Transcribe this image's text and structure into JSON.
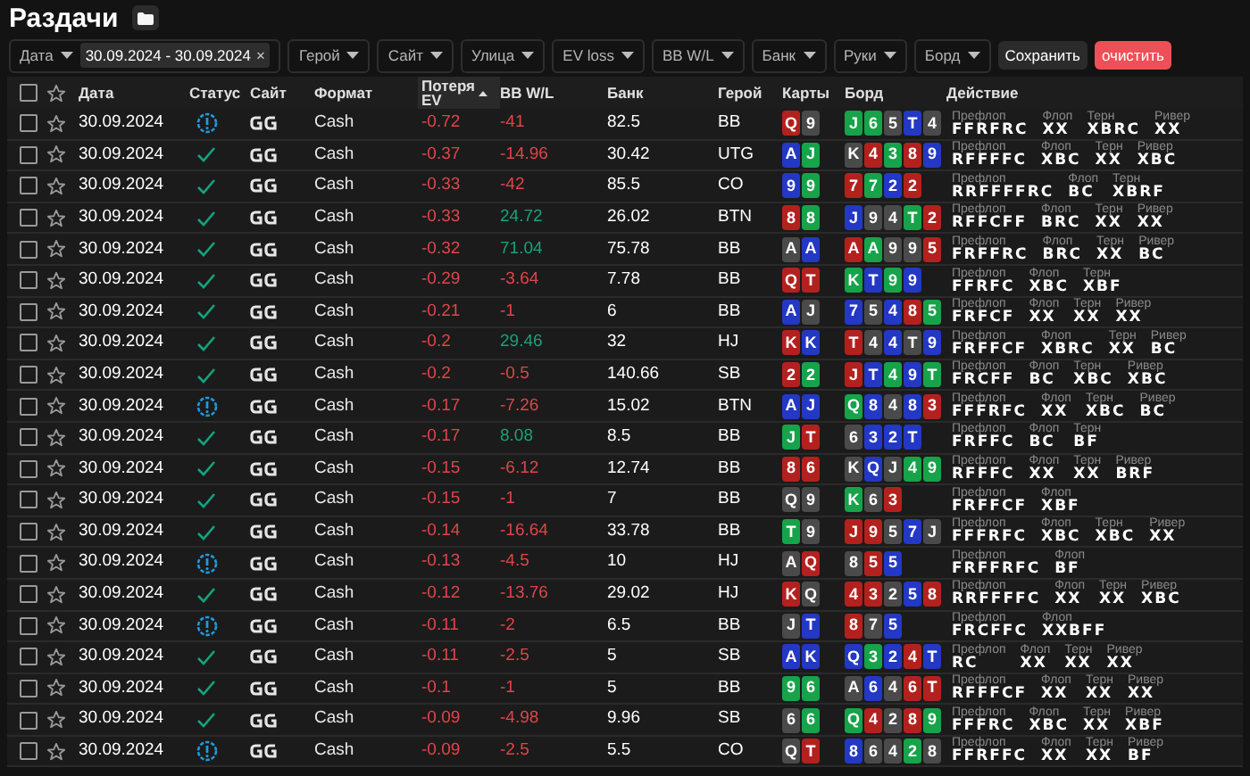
{
  "title": "Раздачи",
  "filters": [
    {
      "label": "Дата",
      "chip": "30.09.2024 - 30.09.2024",
      "chip_close": "×"
    },
    {
      "label": "Герой"
    },
    {
      "label": "Сайт"
    },
    {
      "label": "Улица"
    },
    {
      "label": "EV loss"
    },
    {
      "label": "BB W/L"
    },
    {
      "label": "Банк"
    },
    {
      "label": "Руки"
    },
    {
      "label": "Борд"
    }
  ],
  "save_button": "Сохранить",
  "clear_button": "очистить",
  "header_checkbox": {
    "checked": false
  },
  "columns": [
    {
      "label": "Дата",
      "sorted": false
    },
    {
      "label": "Статус",
      "sorted": false
    },
    {
      "label": "Сайт",
      "sorted": false
    },
    {
      "label": "Формат",
      "sorted": false
    },
    {
      "label": "Потеря EV",
      "sorted": true
    },
    {
      "label": "BB W/L",
      "sorted": false
    },
    {
      "label": "Банк",
      "sorted": false
    },
    {
      "label": "Герой",
      "sorted": false
    },
    {
      "label": "Карты",
      "sorted": false
    },
    {
      "label": "Борд",
      "sorted": false
    },
    {
      "label": "Действие",
      "sorted": false
    }
  ],
  "rows": [
    {
      "checked": false,
      "starred": false,
      "date": "30.09.2024",
      "kind": "warning",
      "format": "Cash",
      "ev_loss": "-0.72",
      "bb_wl": "-41",
      "positive": false,
      "pot": "82.5",
      "hero": "BB",
      "cards": [
        {
          "rank": "Q",
          "color": "#b3211e"
        },
        {
          "rank": "9",
          "color": "#4a4a4a"
        }
      ],
      "board": [
        {
          "rank": "J",
          "color": "#16a34a"
        },
        {
          "rank": "6",
          "color": "#16a34a"
        },
        {
          "rank": "5",
          "color": "#4a4a4a"
        },
        {
          "rank": "T",
          "color": "#2338c4"
        },
        {
          "rank": "4",
          "color": "#4a4a4a"
        }
      ],
      "action": [
        {
          "street": "Префлоп",
          "value": "FFRFRC"
        },
        {
          "street": "Флоп",
          "value": "XX"
        },
        {
          "street": "Терн",
          "value": "XBRC"
        },
        {
          "street": "Ривер",
          "value": "XX"
        }
      ]
    },
    {
      "checked": false,
      "starred": false,
      "date": "30.09.2024",
      "kind": "ok",
      "format": "Cash",
      "ev_loss": "-0.37",
      "bb_wl": "-14.96",
      "positive": false,
      "pot": "30.42",
      "hero": "UTG",
      "cards": [
        {
          "rank": "A",
          "color": "#2338c4"
        },
        {
          "rank": "J",
          "color": "#16a34a"
        }
      ],
      "board": [
        {
          "rank": "K",
          "color": "#4a4a4a"
        },
        {
          "rank": "4",
          "color": "#b3211e"
        },
        {
          "rank": "3",
          "color": "#16a34a"
        },
        {
          "rank": "8",
          "color": "#b3211e"
        },
        {
          "rank": "9",
          "color": "#2338c4"
        }
      ],
      "action": [
        {
          "street": "Префлоп",
          "value": "RFFFFC"
        },
        {
          "street": "Флоп",
          "value": "XBC"
        },
        {
          "street": "Терн",
          "value": "XX"
        },
        {
          "street": "Ривер",
          "value": "XBC"
        }
      ]
    },
    {
      "checked": false,
      "starred": false,
      "date": "30.09.2024",
      "kind": "ok",
      "format": "Cash",
      "ev_loss": "-0.33",
      "bb_wl": "-42",
      "positive": false,
      "pot": "85.5",
      "hero": "CO",
      "cards": [
        {
          "rank": "9",
          "color": "#2338c4"
        },
        {
          "rank": "9",
          "color": "#16a34a"
        }
      ],
      "board": [
        {
          "rank": "7",
          "color": "#b3211e"
        },
        {
          "rank": "7",
          "color": "#16a34a"
        },
        {
          "rank": "2",
          "color": "#2338c4"
        },
        {
          "rank": "2",
          "color": "#b3211e"
        }
      ],
      "action": [
        {
          "street": "Префлоп",
          "value": "RRFFFFRC"
        },
        {
          "street": "Флоп",
          "value": "BC"
        },
        {
          "street": "Терн",
          "value": "XBRF"
        }
      ]
    },
    {
      "checked": false,
      "starred": false,
      "date": "30.09.2024",
      "kind": "ok",
      "format": "Cash",
      "ev_loss": "-0.33",
      "bb_wl": "24.72",
      "positive": true,
      "pot": "26.02",
      "hero": "BTN",
      "cards": [
        {
          "rank": "8",
          "color": "#b3211e"
        },
        {
          "rank": "8",
          "color": "#16a34a"
        }
      ],
      "board": [
        {
          "rank": "J",
          "color": "#2338c4"
        },
        {
          "rank": "9",
          "color": "#4a4a4a"
        },
        {
          "rank": "4",
          "color": "#4a4a4a"
        },
        {
          "rank": "T",
          "color": "#16a34a"
        },
        {
          "rank": "2",
          "color": "#b3211e"
        }
      ],
      "action": [
        {
          "street": "Префлоп",
          "value": "RFFCFF"
        },
        {
          "street": "Флоп",
          "value": "BRC"
        },
        {
          "street": "Терн",
          "value": "XX"
        },
        {
          "street": "Ривер",
          "value": "XX"
        }
      ]
    },
    {
      "checked": false,
      "starred": false,
      "date": "30.09.2024",
      "kind": "ok",
      "format": "Cash",
      "ev_loss": "-0.32",
      "bb_wl": "71.04",
      "positive": true,
      "pot": "75.78",
      "hero": "BB",
      "cards": [
        {
          "rank": "A",
          "color": "#4a4a4a"
        },
        {
          "rank": "A",
          "color": "#2338c4"
        }
      ],
      "board": [
        {
          "rank": "A",
          "color": "#b3211e"
        },
        {
          "rank": "A",
          "color": "#16a34a"
        },
        {
          "rank": "9",
          "color": "#4a4a4a"
        },
        {
          "rank": "9",
          "color": "#4a4a4a"
        },
        {
          "rank": "5",
          "color": "#b3211e"
        }
      ],
      "action": [
        {
          "street": "Префлоп",
          "value": "FRFFRC"
        },
        {
          "street": "Флоп",
          "value": "BRC"
        },
        {
          "street": "Терн",
          "value": "XX"
        },
        {
          "street": "Ривер",
          "value": "BC"
        }
      ]
    },
    {
      "checked": false,
      "starred": false,
      "date": "30.09.2024",
      "kind": "ok",
      "format": "Cash",
      "ev_loss": "-0.29",
      "bb_wl": "-3.64",
      "positive": false,
      "pot": "7.78",
      "hero": "BB",
      "cards": [
        {
          "rank": "Q",
          "color": "#b3211e"
        },
        {
          "rank": "T",
          "color": "#b3211e"
        }
      ],
      "board": [
        {
          "rank": "K",
          "color": "#16a34a"
        },
        {
          "rank": "T",
          "color": "#2338c4"
        },
        {
          "rank": "9",
          "color": "#16a34a"
        },
        {
          "rank": "9",
          "color": "#2338c4"
        }
      ],
      "action": [
        {
          "street": "Префлоп",
          "value": "FFRFC"
        },
        {
          "street": "Флоп",
          "value": "XBC"
        },
        {
          "street": "Терн",
          "value": "XBF"
        }
      ]
    },
    {
      "checked": false,
      "starred": false,
      "date": "30.09.2024",
      "kind": "ok",
      "format": "Cash",
      "ev_loss": "-0.21",
      "bb_wl": "-1",
      "positive": false,
      "pot": "6",
      "hero": "BB",
      "cards": [
        {
          "rank": "A",
          "color": "#2338c4"
        },
        {
          "rank": "J",
          "color": "#4a4a4a"
        }
      ],
      "board": [
        {
          "rank": "7",
          "color": "#2338c4"
        },
        {
          "rank": "5",
          "color": "#4a4a4a"
        },
        {
          "rank": "4",
          "color": "#2338c4"
        },
        {
          "rank": "8",
          "color": "#b3211e"
        },
        {
          "rank": "5",
          "color": "#16a34a"
        }
      ],
      "action": [
        {
          "street": "Префлоп",
          "value": "FRFCF"
        },
        {
          "street": "Флоп",
          "value": "XX"
        },
        {
          "street": "Терн",
          "value": "XX"
        },
        {
          "street": "Ривер",
          "value": "XX"
        }
      ]
    },
    {
      "checked": false,
      "starred": false,
      "date": "30.09.2024",
      "kind": "ok",
      "format": "Cash",
      "ev_loss": "-0.2",
      "bb_wl": "29.46",
      "positive": true,
      "pot": "32",
      "hero": "HJ",
      "cards": [
        {
          "rank": "K",
          "color": "#b3211e"
        },
        {
          "rank": "K",
          "color": "#2338c4"
        }
      ],
      "board": [
        {
          "rank": "T",
          "color": "#b3211e"
        },
        {
          "rank": "4",
          "color": "#4a4a4a"
        },
        {
          "rank": "4",
          "color": "#2338c4"
        },
        {
          "rank": "T",
          "color": "#4a4a4a"
        },
        {
          "rank": "9",
          "color": "#2338c4"
        }
      ],
      "action": [
        {
          "street": "Префлоп",
          "value": "FRFFCF"
        },
        {
          "street": "Флоп",
          "value": "XBRC"
        },
        {
          "street": "Терн",
          "value": "XX"
        },
        {
          "street": "Ривер",
          "value": "BC"
        }
      ]
    },
    {
      "checked": false,
      "starred": false,
      "date": "30.09.2024",
      "kind": "ok",
      "format": "Cash",
      "ev_loss": "-0.2",
      "bb_wl": "-0.5",
      "positive": false,
      "pot": "140.66",
      "hero": "SB",
      "cards": [
        {
          "rank": "2",
          "color": "#b3211e"
        },
        {
          "rank": "2",
          "color": "#16a34a"
        }
      ],
      "board": [
        {
          "rank": "J",
          "color": "#b3211e"
        },
        {
          "rank": "T",
          "color": "#2338c4"
        },
        {
          "rank": "4",
          "color": "#16a34a"
        },
        {
          "rank": "9",
          "color": "#2338c4"
        },
        {
          "rank": "T",
          "color": "#16a34a"
        }
      ],
      "action": [
        {
          "street": "Префлоп",
          "value": "FRCFF"
        },
        {
          "street": "Флоп",
          "value": "BC"
        },
        {
          "street": "Терн",
          "value": "XBC"
        },
        {
          "street": "Ривер",
          "value": "XBC"
        }
      ]
    },
    {
      "checked": false,
      "starred": false,
      "date": "30.09.2024",
      "kind": "warning",
      "format": "Cash",
      "ev_loss": "-0.17",
      "bb_wl": "-7.26",
      "positive": false,
      "pot": "15.02",
      "hero": "BTN",
      "cards": [
        {
          "rank": "A",
          "color": "#2338c4"
        },
        {
          "rank": "J",
          "color": "#2338c4"
        }
      ],
      "board": [
        {
          "rank": "Q",
          "color": "#16a34a"
        },
        {
          "rank": "8",
          "color": "#2338c4"
        },
        {
          "rank": "4",
          "color": "#4a4a4a"
        },
        {
          "rank": "8",
          "color": "#2338c4"
        },
        {
          "rank": "3",
          "color": "#b3211e"
        }
      ],
      "action": [
        {
          "street": "Префлоп",
          "value": "FFFRFC"
        },
        {
          "street": "Флоп",
          "value": "XX"
        },
        {
          "street": "Терн",
          "value": "XBC"
        },
        {
          "street": "Ривер",
          "value": "BC"
        }
      ]
    },
    {
      "checked": false,
      "starred": false,
      "date": "30.09.2024",
      "kind": "ok",
      "format": "Cash",
      "ev_loss": "-0.17",
      "bb_wl": "8.08",
      "positive": true,
      "pot": "8.5",
      "hero": "BB",
      "cards": [
        {
          "rank": "J",
          "color": "#16a34a"
        },
        {
          "rank": "T",
          "color": "#b3211e"
        }
      ],
      "board": [
        {
          "rank": "6",
          "color": "#4a4a4a"
        },
        {
          "rank": "3",
          "color": "#2338c4"
        },
        {
          "rank": "2",
          "color": "#2338c4"
        },
        {
          "rank": "T",
          "color": "#2338c4"
        }
      ],
      "action": [
        {
          "street": "Префлоп",
          "value": "FRFFC"
        },
        {
          "street": "Флоп",
          "value": "BC"
        },
        {
          "street": "Терн",
          "value": "BF"
        }
      ]
    },
    {
      "checked": false,
      "starred": false,
      "date": "30.09.2024",
      "kind": "ok",
      "format": "Cash",
      "ev_loss": "-0.15",
      "bb_wl": "-6.12",
      "positive": false,
      "pot": "12.74",
      "hero": "BB",
      "cards": [
        {
          "rank": "8",
          "color": "#b3211e"
        },
        {
          "rank": "6",
          "color": "#b3211e"
        }
      ],
      "board": [
        {
          "rank": "K",
          "color": "#4a4a4a"
        },
        {
          "rank": "Q",
          "color": "#2338c4"
        },
        {
          "rank": "J",
          "color": "#4a4a4a"
        },
        {
          "rank": "4",
          "color": "#16a34a"
        },
        {
          "rank": "9",
          "color": "#16a34a"
        }
      ],
      "action": [
        {
          "street": "Префлоп",
          "value": "RFFFC"
        },
        {
          "street": "Флоп",
          "value": "XX"
        },
        {
          "street": "Терн",
          "value": "XX"
        },
        {
          "street": "Ривер",
          "value": "BRF"
        }
      ]
    },
    {
      "checked": false,
      "starred": false,
      "date": "30.09.2024",
      "kind": "ok",
      "format": "Cash",
      "ev_loss": "-0.15",
      "bb_wl": "-1",
      "positive": false,
      "pot": "7",
      "hero": "BB",
      "cards": [
        {
          "rank": "Q",
          "color": "#4a4a4a"
        },
        {
          "rank": "9",
          "color": "#4a4a4a"
        }
      ],
      "board": [
        {
          "rank": "K",
          "color": "#16a34a"
        },
        {
          "rank": "6",
          "color": "#4a4a4a"
        },
        {
          "rank": "3",
          "color": "#b3211e"
        }
      ],
      "action": [
        {
          "street": "Префлоп",
          "value": "FRFFCF"
        },
        {
          "street": "Флоп",
          "value": "XBF"
        }
      ]
    },
    {
      "checked": false,
      "starred": false,
      "date": "30.09.2024",
      "kind": "ok",
      "format": "Cash",
      "ev_loss": "-0.14",
      "bb_wl": "-16.64",
      "positive": false,
      "pot": "33.78",
      "hero": "BB",
      "cards": [
        {
          "rank": "T",
          "color": "#16a34a"
        },
        {
          "rank": "9",
          "color": "#4a4a4a"
        }
      ],
      "board": [
        {
          "rank": "J",
          "color": "#b3211e"
        },
        {
          "rank": "9",
          "color": "#b3211e"
        },
        {
          "rank": "5",
          "color": "#4a4a4a"
        },
        {
          "rank": "7",
          "color": "#2338c4"
        },
        {
          "rank": "J",
          "color": "#4a4a4a"
        }
      ],
      "action": [
        {
          "street": "Префлоп",
          "value": "FFFRFC"
        },
        {
          "street": "Флоп",
          "value": "XBC"
        },
        {
          "street": "Терн",
          "value": "XBC"
        },
        {
          "street": "Ривер",
          "value": "XX"
        }
      ]
    },
    {
      "checked": false,
      "starred": false,
      "date": "30.09.2024",
      "kind": "warning",
      "format": "Cash",
      "ev_loss": "-0.13",
      "bb_wl": "-4.5",
      "positive": false,
      "pot": "10",
      "hero": "HJ",
      "cards": [
        {
          "rank": "A",
          "color": "#4a4a4a"
        },
        {
          "rank": "Q",
          "color": "#b3211e"
        }
      ],
      "board": [
        {
          "rank": "8",
          "color": "#4a4a4a"
        },
        {
          "rank": "5",
          "color": "#b3211e"
        },
        {
          "rank": "5",
          "color": "#2338c4"
        }
      ],
      "action": [
        {
          "street": "Префлоп",
          "value": "FRFFRFC"
        },
        {
          "street": "Флоп",
          "value": "BF"
        }
      ]
    },
    {
      "checked": false,
      "starred": false,
      "date": "30.09.2024",
      "kind": "ok",
      "format": "Cash",
      "ev_loss": "-0.12",
      "bb_wl": "-13.76",
      "positive": false,
      "pot": "29.02",
      "hero": "HJ",
      "cards": [
        {
          "rank": "K",
          "color": "#b3211e"
        },
        {
          "rank": "Q",
          "color": "#4a4a4a"
        }
      ],
      "board": [
        {
          "rank": "4",
          "color": "#b3211e"
        },
        {
          "rank": "3",
          "color": "#b3211e"
        },
        {
          "rank": "2",
          "color": "#4a4a4a"
        },
        {
          "rank": "5",
          "color": "#2338c4"
        },
        {
          "rank": "8",
          "color": "#b3211e"
        }
      ],
      "action": [
        {
          "street": "Префлоп",
          "value": "RRFFFFC"
        },
        {
          "street": "Флоп",
          "value": "XX"
        },
        {
          "street": "Терн",
          "value": "XX"
        },
        {
          "street": "Ривер",
          "value": "XBC"
        }
      ]
    },
    {
      "checked": false,
      "starred": false,
      "date": "30.09.2024",
      "kind": "warning",
      "format": "Cash",
      "ev_loss": "-0.11",
      "bb_wl": "-2",
      "positive": false,
      "pot": "6.5",
      "hero": "BB",
      "cards": [
        {
          "rank": "J",
          "color": "#4a4a4a"
        },
        {
          "rank": "T",
          "color": "#2338c4"
        }
      ],
      "board": [
        {
          "rank": "8",
          "color": "#b3211e"
        },
        {
          "rank": "7",
          "color": "#4a4a4a"
        },
        {
          "rank": "5",
          "color": "#2338c4"
        }
      ],
      "action": [
        {
          "street": "Префлоп",
          "value": "FRCFFC"
        },
        {
          "street": "Флоп",
          "value": "XXBFF"
        }
      ]
    },
    {
      "checked": false,
      "starred": false,
      "date": "30.09.2024",
      "kind": "ok",
      "format": "Cash",
      "ev_loss": "-0.11",
      "bb_wl": "-2.5",
      "positive": false,
      "pot": "5",
      "hero": "SB",
      "cards": [
        {
          "rank": "A",
          "color": "#2338c4"
        },
        {
          "rank": "K",
          "color": "#2338c4"
        }
      ],
      "board": [
        {
          "rank": "Q",
          "color": "#2338c4"
        },
        {
          "rank": "3",
          "color": "#16a34a"
        },
        {
          "rank": "2",
          "color": "#2338c4"
        },
        {
          "rank": "4",
          "color": "#b3211e"
        },
        {
          "rank": "T",
          "color": "#2338c4"
        }
      ],
      "action": [
        {
          "street": "Префлоп",
          "value": "RC"
        },
        {
          "street": "Флоп",
          "value": "XX"
        },
        {
          "street": "Терн",
          "value": "XX"
        },
        {
          "street": "Ривер",
          "value": "XX"
        }
      ]
    },
    {
      "checked": false,
      "starred": false,
      "date": "30.09.2024",
      "kind": "ok",
      "format": "Cash",
      "ev_loss": "-0.1",
      "bb_wl": "-1",
      "positive": false,
      "pot": "5",
      "hero": "BB",
      "cards": [
        {
          "rank": "9",
          "color": "#16a34a"
        },
        {
          "rank": "6",
          "color": "#16a34a"
        }
      ],
      "board": [
        {
          "rank": "A",
          "color": "#4a4a4a"
        },
        {
          "rank": "6",
          "color": "#2338c4"
        },
        {
          "rank": "4",
          "color": "#4a4a4a"
        },
        {
          "rank": "6",
          "color": "#b3211e"
        },
        {
          "rank": "T",
          "color": "#b3211e"
        }
      ],
      "action": [
        {
          "street": "Префлоп",
          "value": "RFFFCF"
        },
        {
          "street": "Флоп",
          "value": "XX"
        },
        {
          "street": "Терн",
          "value": "XX"
        },
        {
          "street": "Ривер",
          "value": "XX"
        }
      ]
    },
    {
      "checked": false,
      "starred": false,
      "date": "30.09.2024",
      "kind": "ok",
      "format": "Cash",
      "ev_loss": "-0.09",
      "bb_wl": "-4.98",
      "positive": false,
      "pot": "9.96",
      "hero": "SB",
      "cards": [
        {
          "rank": "6",
          "color": "#4a4a4a"
        },
        {
          "rank": "6",
          "color": "#16a34a"
        }
      ],
      "board": [
        {
          "rank": "Q",
          "color": "#16a34a"
        },
        {
          "rank": "4",
          "color": "#b3211e"
        },
        {
          "rank": "2",
          "color": "#4a4a4a"
        },
        {
          "rank": "8",
          "color": "#b3211e"
        },
        {
          "rank": "9",
          "color": "#16a34a"
        }
      ],
      "action": [
        {
          "street": "Префлоп",
          "value": "FFFRC"
        },
        {
          "street": "Флоп",
          "value": "XBC"
        },
        {
          "street": "Терн",
          "value": "XX"
        },
        {
          "street": "Ривер",
          "value": "XBF"
        }
      ]
    },
    {
      "checked": false,
      "starred": false,
      "date": "30.09.2024",
      "kind": "warning",
      "format": "Cash",
      "ev_loss": "-0.09",
      "bb_wl": "-2.5",
      "positive": false,
      "pot": "5.5",
      "hero": "CO",
      "cards": [
        {
          "rank": "Q",
          "color": "#4a4a4a"
        },
        {
          "rank": "T",
          "color": "#b3211e"
        }
      ],
      "board": [
        {
          "rank": "8",
          "color": "#2338c4"
        },
        {
          "rank": "6",
          "color": "#4a4a4a"
        },
        {
          "rank": "4",
          "color": "#4a4a4a"
        },
        {
          "rank": "2",
          "color": "#16a34a"
        },
        {
          "rank": "8",
          "color": "#4a4a4a"
        }
      ],
      "action": [
        {
          "street": "Префлоп",
          "value": "FFRFFC"
        },
        {
          "street": "Флоп",
          "value": "XX"
        },
        {
          "street": "Терн",
          "value": "XX"
        },
        {
          "street": "Ривер",
          "value": "BF"
        }
      ]
    }
  ]
}
